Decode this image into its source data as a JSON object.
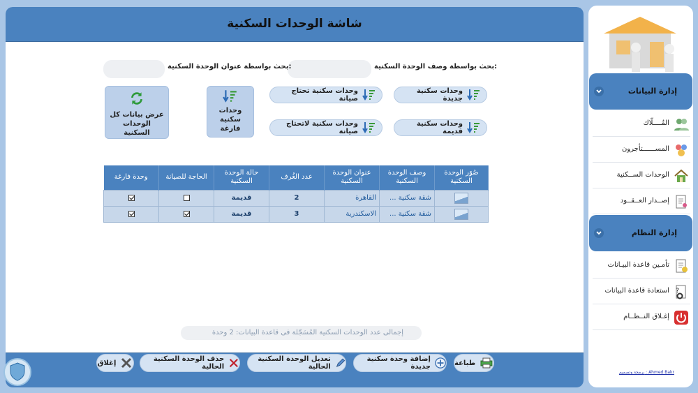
{
  "title": "شاشة الوحدات السكنية",
  "search": {
    "by_description_label": "بحث بواسطة وصف الوحدة السكنية:",
    "by_address_label": "بحث بواسطة عنوان الوحدة السكنية:",
    "by_description_value": "",
    "by_address_value": ""
  },
  "filters": {
    "new_units": "وحدات سكنية جديدة",
    "old_units": "وحدات سكنية قديمة",
    "needs_maintenance": "وحدات سكنية تحتاج صيانة",
    "no_maintenance": "وحدات سكنية لاتحتاج صيانة",
    "empty_units": "وحدات سكنية فارغة",
    "show_all": "عرض بيانات كل الوحدات السكنية"
  },
  "table": {
    "headers": [
      "صُوَر الوحدة السكنية",
      "وصف الوحدة السكنية",
      "عنوان الوحدة السكنية",
      "عدد الغُرف",
      "حالة الوحدة السكنية",
      "الحاجة للصيانة",
      "وحدة فارغة"
    ],
    "rows": [
      {
        "description": "شقة سكنية ...",
        "address": "القاهرة",
        "rooms": "2",
        "status": "قديمة",
        "maintenance": false,
        "empty": true
      },
      {
        "description": "شقة سكنية ...",
        "address": "الاسكندرية",
        "rooms": "3",
        "status": "قديمة",
        "maintenance": true,
        "empty": true
      }
    ]
  },
  "total_text": "إجمالى عدد الوحدات السكنية المُسَجّلة فى قاعدة البيانات: 2 وحدة",
  "footer": {
    "print": "طباعة",
    "add": "إضافة وحدة سكنية جديدة",
    "edit": "تعديل الوحدة السكنية الحالية",
    "delete": "حذف الوحدة السكنية الحالية",
    "close": "إغلاق"
  },
  "sidebar": {
    "data_section": "إدارة البيانات",
    "system_section": "إدارة النظام",
    "items": {
      "owners": "المُــــلّاك",
      "tenants": "المســــــتأجرون",
      "units": "الوحدات الســكنية",
      "contracts": "إصــدار العــقــود",
      "backup": "تأمـين قاعدة البيـانات",
      "restore": "استعادة قاعدة البيانات",
      "shutdown": "إغـلاق النــظــام"
    },
    "author": "برمجة وتصميم : Ahmed Bakr"
  },
  "colors": {
    "header": "#4a82bf",
    "background": "#a9c6e6",
    "button": "#d5e3f3"
  }
}
